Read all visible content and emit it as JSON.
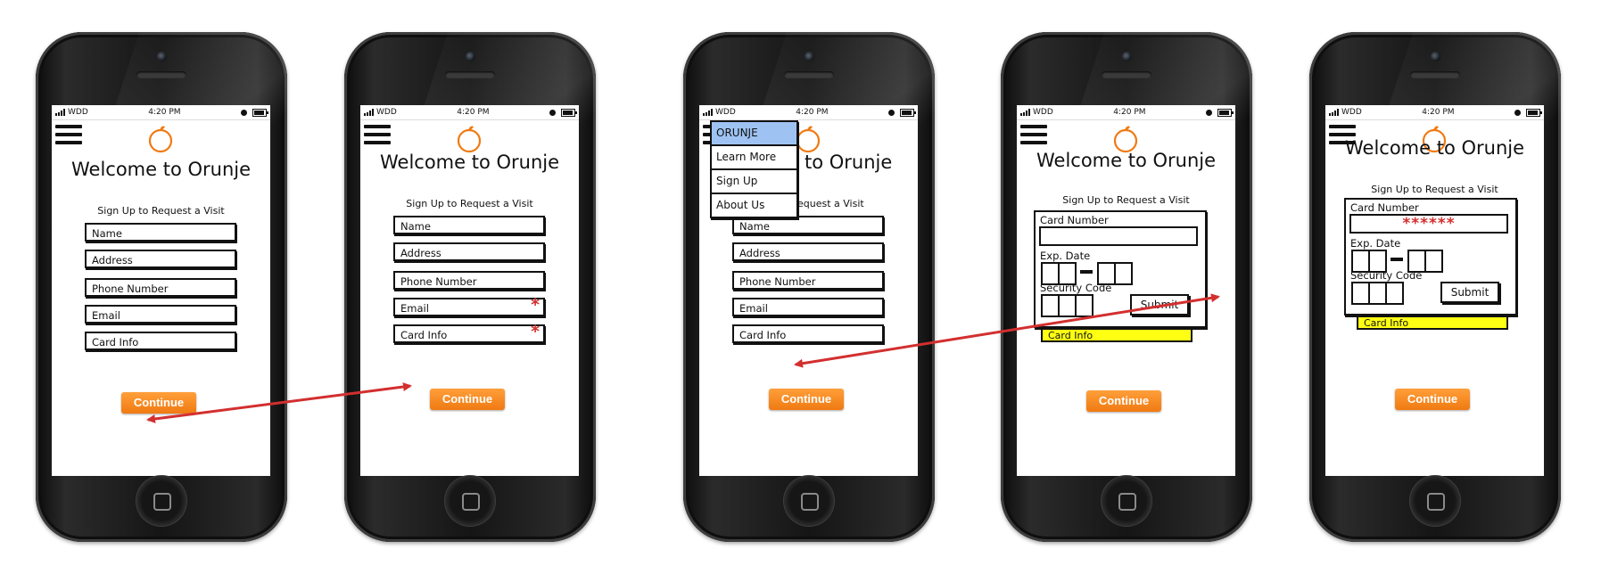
{
  "status_bar": {
    "carrier": "WDD",
    "time": "4:20 PM"
  },
  "app": {
    "title": "Welcome to Orunje",
    "form_label": "Sign Up to Request a Visit"
  },
  "fields": {
    "name": "Name",
    "address": "Address",
    "phone": "Phone Number",
    "email": "Email",
    "card_info": "Card Info"
  },
  "required_marker": "*",
  "continue_label": "Continue",
  "menu": {
    "items": [
      {
        "label": "ORUNJE"
      },
      {
        "label": "Learn More"
      },
      {
        "label": "Sign Up"
      },
      {
        "label": "About Us"
      }
    ]
  },
  "menu_partial": {
    "title_tail": "to Orunje",
    "form_label_tail": "equest a Visit"
  },
  "card_panel": {
    "card_number_label": "Card Number",
    "exp_date_label": "Exp. Date",
    "security_code_label": "Security Code",
    "submit_label": "Submit",
    "masked_number": "******"
  },
  "colors": {
    "accent_orange": "#f07a12",
    "required_red": "#d32f2f",
    "menu_highlight": "#9ec3f3",
    "highlight_yellow": "#ffff14",
    "arrow_red": "#d32f2f"
  }
}
